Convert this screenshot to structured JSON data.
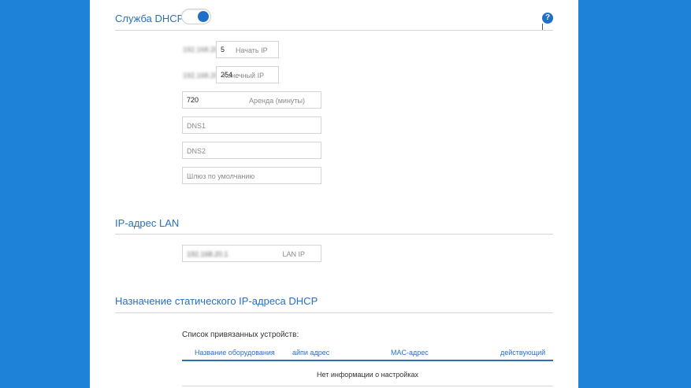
{
  "dhcp": {
    "title": "Служба DHCP",
    "toggle_state": "on",
    "help_label": "?",
    "start_ip_prefix": "192.168.20.",
    "start_ip_value": "5",
    "start_ip_placeholder": "Начать IP",
    "end_ip_prefix": "192.168.20.",
    "end_ip_value": "254",
    "end_ip_placeholder": "Конечный IP",
    "lease_value": "720",
    "lease_placeholder": "Аренда (минуты)",
    "dns1_placeholder": "DNS1",
    "dns2_placeholder": "DNS2",
    "gateway_placeholder": "Шлюз по умолчанию"
  },
  "lan": {
    "title": "IP-адрес LAN",
    "ip_value": "192.168.20.1",
    "ip_placeholder": "LAN IP"
  },
  "static": {
    "title": "Назначение статического IP-адреса DHCP",
    "list_caption": "Список привязанных устройств:",
    "columns": [
      "Название оборудования",
      "айпи адрес",
      "MAC-адрес",
      "действующий"
    ],
    "empty_message": "Нет информации о настройках"
  },
  "colors": {
    "background": "#1e82d8",
    "accent": "#2a6fc0",
    "toggle_on": "#1f6fc8"
  }
}
